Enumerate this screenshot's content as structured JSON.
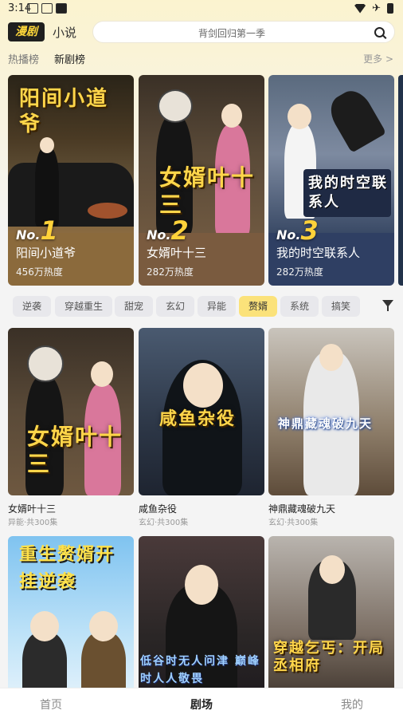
{
  "status_bar": {
    "time": "3:14"
  },
  "header": {
    "logo": "漫剧",
    "novel_tab": "小说",
    "search_placeholder": "背剑回归第一季"
  },
  "rank_tabs": [
    {
      "label": "热播榜",
      "active": false
    },
    {
      "label": "新剧榜",
      "active": true
    }
  ],
  "more_label": "更多 >",
  "ranking": [
    {
      "rank_prefix": "No.",
      "rank": "1",
      "title": "阳间小道爷",
      "heat": "456万热度",
      "cover_text": "阳间小道爷",
      "info_color": "#8b6a3c"
    },
    {
      "rank_prefix": "No.",
      "rank": "2",
      "title": "女婿叶十三",
      "heat": "282万热度",
      "cover_text": "女婿叶十三",
      "info_color": "#7a5b3f"
    },
    {
      "rank_prefix": "No.",
      "rank": "3",
      "title": "我的时空联系人",
      "heat": "282万热度",
      "cover_text": "我的时空联系人",
      "info_color": "#2f3f63"
    }
  ],
  "genres": [
    {
      "label": "逆袭",
      "active": false
    },
    {
      "label": "穿越重生",
      "active": false
    },
    {
      "label": "甜宠",
      "active": false
    },
    {
      "label": "玄幻",
      "active": false
    },
    {
      "label": "异能",
      "active": false
    },
    {
      "label": "赘婿",
      "active": true
    },
    {
      "label": "系统",
      "active": false
    },
    {
      "label": "搞笑",
      "active": false
    }
  ],
  "grid": [
    {
      "title": "女婿叶十三",
      "meta": "异能·共300集",
      "cover_text": "女婿叶十三"
    },
    {
      "title": "咸鱼杂役",
      "meta": "玄幻·共300集",
      "cover_text": "咸鱼杂役"
    },
    {
      "title": "神鼎藏魂破九天",
      "meta": "玄幻·共300集",
      "cover_text": "神鼎藏魂破九天"
    },
    {
      "title": "",
      "meta": "",
      "cover_text": "重生赘婿开挂逆袭"
    },
    {
      "title": "",
      "meta": "",
      "cover_text": "低谷时无人问津 巅峰时人人敬畏"
    },
    {
      "title": "",
      "meta": "",
      "cover_text": "穿越乞丐：开局丞相府"
    }
  ],
  "bottom_nav": [
    {
      "label": "首页",
      "active": false
    },
    {
      "label": "剧场",
      "active": true
    },
    {
      "label": "我的",
      "active": false
    }
  ]
}
